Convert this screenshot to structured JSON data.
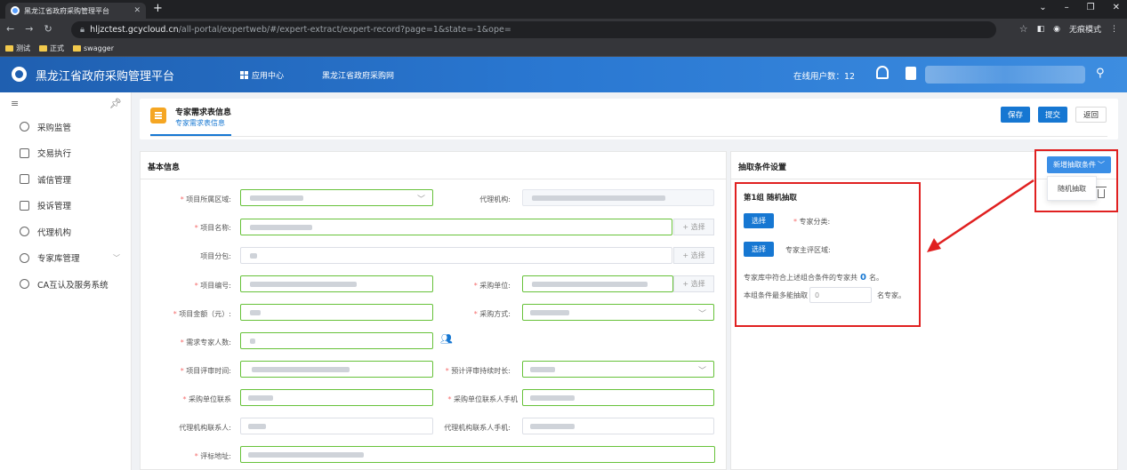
{
  "browser": {
    "tab_title": "黑龙江省政府采购管理平台",
    "url_host": "hljzctest.gcycloud.cn",
    "url_path": "/all-portal/expertweb/#/expert-extract/expert-record?page=1&state=-1&ope=",
    "incognito_label": "无痕模式",
    "bookmarks": [
      "测试",
      "正式",
      "swagger"
    ]
  },
  "header": {
    "app_name": "黑龙江省政府采购管理平台",
    "app_center": "应用中心",
    "gov_link": "黑龙江省政府采购网",
    "online_users": "在线用户数：12"
  },
  "sidebar": {
    "items": [
      {
        "label": "采购监管"
      },
      {
        "label": "交易执行"
      },
      {
        "label": "诚信管理"
      },
      {
        "label": "投诉管理"
      },
      {
        "label": "代理机构"
      },
      {
        "label": "专家库管理"
      },
      {
        "label": "CA互认及服务系统"
      }
    ]
  },
  "page": {
    "title": "专家需求表信息",
    "subtab": "专家需求表信息",
    "save": "保存",
    "submit": "提交",
    "back": "返回"
  },
  "basic": {
    "title": "基本信息",
    "select_label": "+ 选择",
    "fields": {
      "region": "项目所属区域:",
      "agency": "代理机构:",
      "name": "项目名称:",
      "package": "项目分包:",
      "code": "项目编号:",
      "buyer": "采购单位:",
      "amount": "项目金额（元）:",
      "method": "采购方式:",
      "experts_needed": "需求专家人数:",
      "review_time": "项目评审时间:",
      "duration": "预计评审持续时长:",
      "buyer_contact": "采购单位联系",
      "buyer_phone": "采购单位联系人手机",
      "agency_contact": "代理机构联系人:",
      "agency_phone": "代理机构联系人手机:",
      "address": "评标地址:"
    }
  },
  "extract": {
    "title": "抽取条件设置",
    "add_condition": "新增抽取条件",
    "dropdown_item": "随机抽取",
    "group_title": "第1组  随机抽取",
    "choose": "选择",
    "expert_category": "专家分类:",
    "expert_region": "专家主评区域:",
    "count_prefix": "专家库中符合上述组合条件的专家共",
    "count_value": "0",
    "count_suffix": "名。",
    "max_prefix": "本组条件最多能抽取",
    "max_placeholder": "0",
    "max_suffix": "名专家。"
  },
  "colors": {
    "primary": "#1677d2",
    "header_blue": "#2a78d2",
    "annotation_red": "#e02020",
    "required": "#f56c6c"
  }
}
